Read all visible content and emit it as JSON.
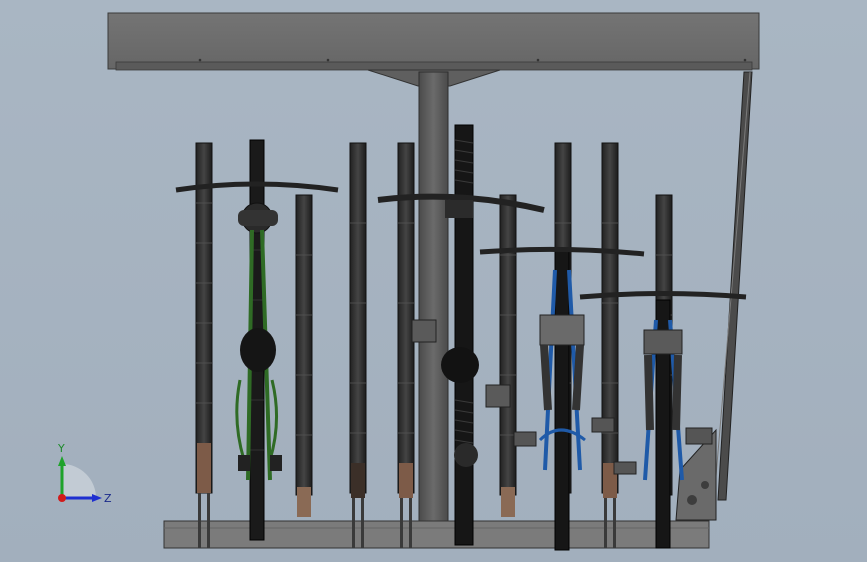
{
  "view": {
    "background": "#a7b4c1",
    "model": "bike-rack-with-canopy"
  },
  "triad": {
    "y_label": "Y",
    "z_label": "Z",
    "y_color": "#1fa32b",
    "z_color": "#1e2fd0",
    "x_color": "#d11a1a"
  },
  "colors": {
    "canopy": "#6f6f6f",
    "post": "#5e5e5e",
    "base": "#7a7a7a",
    "bike_frame_green": "#2f6b25",
    "bike_frame_blue": "#1f5aa8",
    "dark": "#1b1b1b",
    "rubber_pad": "#8a6a55"
  }
}
